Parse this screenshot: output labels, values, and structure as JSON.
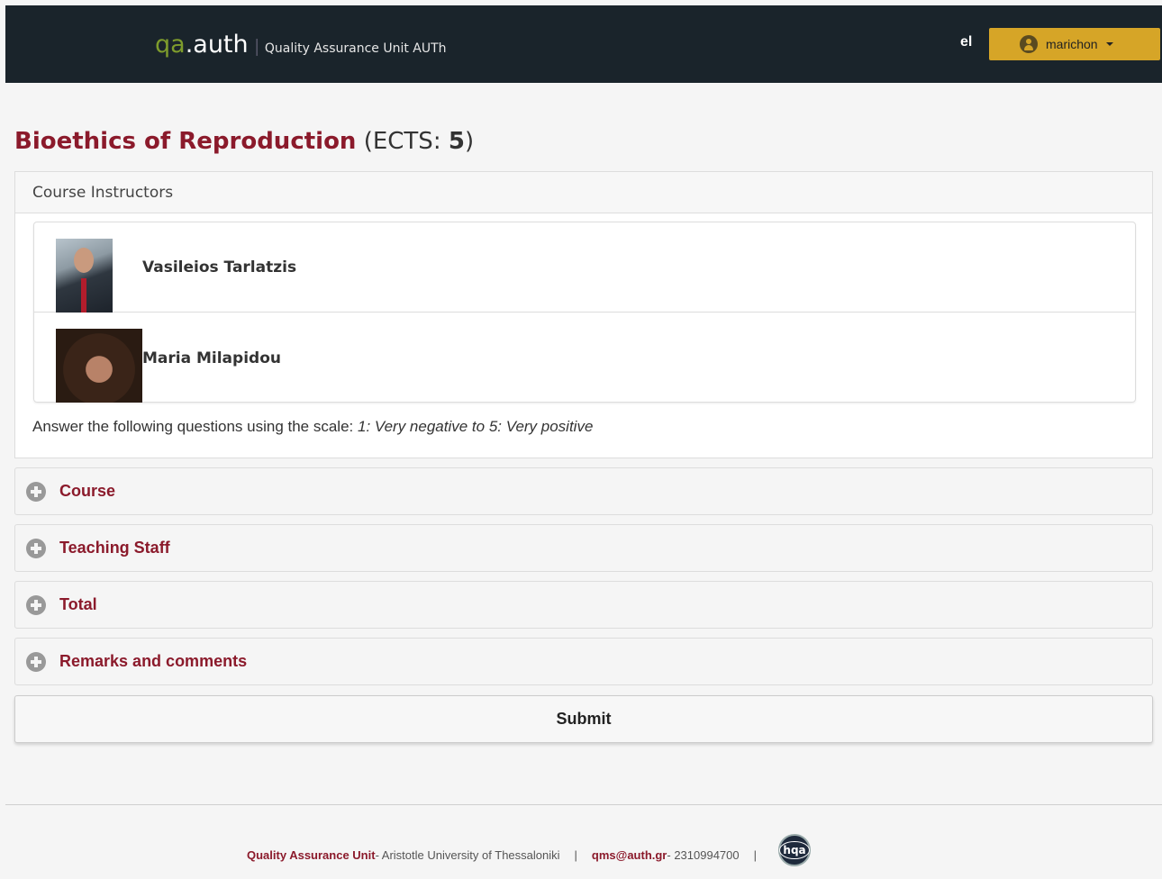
{
  "navbar": {
    "brand_qa": "qa",
    "brand_auth": ".auth",
    "brand_separator": "|",
    "brand_subtitle": "Quality Assurance Unit AUTh",
    "language": "el",
    "user": {
      "name": "marichon",
      "avatar_icon": "user-avatar-icon",
      "caret_icon": "caret-down-icon"
    }
  },
  "course": {
    "name": "Bioethics of Reproduction",
    "ects_prefix": "(ECTS: ",
    "ects_value": "5",
    "ects_suffix": ")"
  },
  "instructors_panel": {
    "heading": "Course Instructors",
    "instructors": [
      {
        "name": "Vasileios Tarlatzis"
      },
      {
        "name": "Maria Milapidou"
      }
    ],
    "scale_prefix": "Answer the following questions using the scale: ",
    "scale_text": "1: Very negative to 5: Very positive"
  },
  "sections": [
    {
      "label": "Course",
      "icon": "plus-circle-icon"
    },
    {
      "label": "Teaching Staff",
      "icon": "plus-circle-icon"
    },
    {
      "label": "Total",
      "icon": "plus-circle-icon"
    },
    {
      "label": "Remarks and comments",
      "icon": "plus-circle-icon"
    }
  ],
  "submit_label": "Submit",
  "footer": {
    "unit": "Quality Assurance Unit",
    "university": " - Aristotle University of Thessaloniki",
    "separator": "|",
    "email": "qms@auth.gr",
    "phone": " - 2310994700",
    "logo_text": "hqa"
  },
  "colors": {
    "navbar_bg": "#1a242b",
    "brand_green": "#7e9c2c",
    "accent_maroon": "#8b1a2b",
    "user_button": "#d6a527"
  }
}
